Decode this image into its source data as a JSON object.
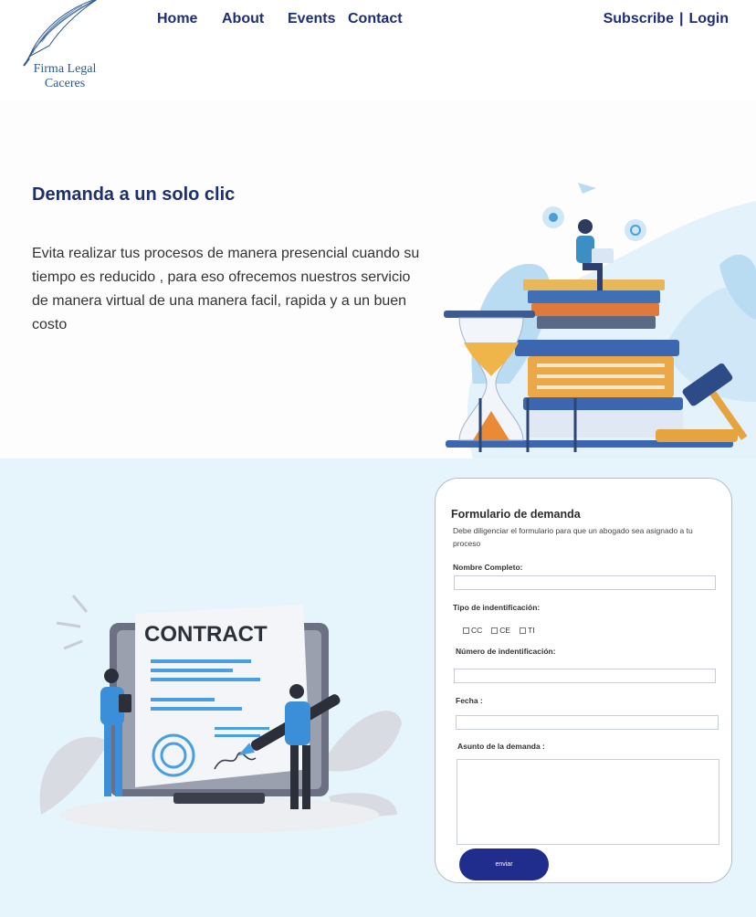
{
  "brand": {
    "line1": "Firma  Legal",
    "line2": "Caceres"
  },
  "nav": {
    "home": "Home",
    "about": "About",
    "events": "Events",
    "contact": "Contact"
  },
  "auth": {
    "subscribe": "Subscribe",
    "separator": "|",
    "login": "Login"
  },
  "hero": {
    "title": "Demanda a un solo clic",
    "text": "Evita realizar tus procesos de manera presencial cuando su tiempo es reducido , para eso ofrecemos nuestros servicio de manera virtual de una manera facil, rapida y a un buen costo"
  },
  "illustration": {
    "contract_label": "CONTRACT"
  },
  "form": {
    "title": "Formulario de demanda",
    "description": "Debe diligenciar el formulario para que un abogado sea asignado a tu proceso",
    "full_name_label": "Nombre Completo:",
    "id_type_label": "Tipo de indentificación:",
    "id_options": [
      "CC",
      "CE",
      "TI"
    ],
    "id_number_label": "Número de indentificación:",
    "date_label": "Fecha :",
    "subject_label": "Asunto de la demanda :",
    "submit_label": "enviar"
  },
  "colors": {
    "navy": "#1f2d78",
    "button": "#202d8c",
    "lower_bg": "#e6f4fb"
  }
}
